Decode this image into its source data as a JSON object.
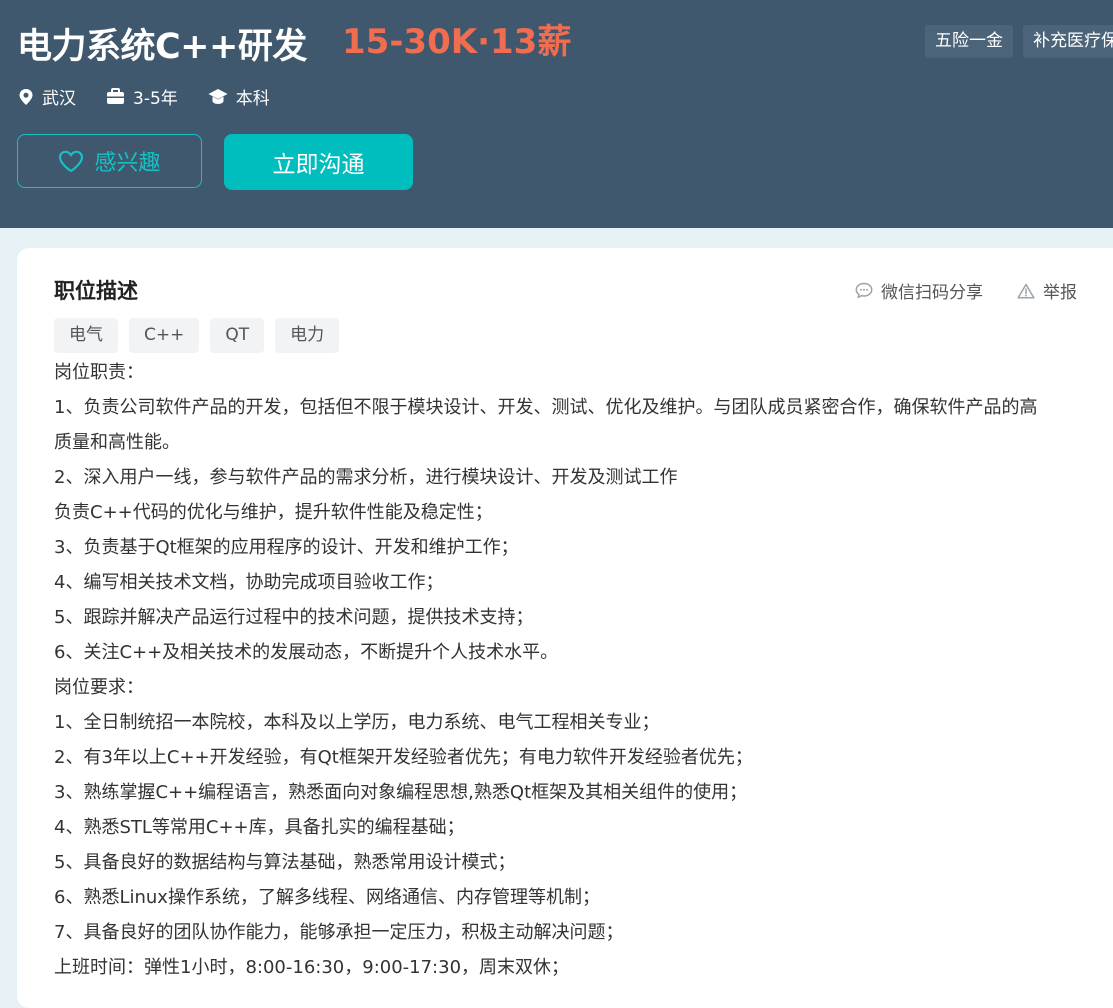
{
  "header": {
    "title": "电力系统C++研发",
    "salary": "15-30K·13薪",
    "benefits": [
      "五险一金",
      "补充医疗保"
    ],
    "meta": {
      "location": "武汉",
      "experience": "3-5年",
      "education": "本科"
    },
    "interest_label": "感兴趣",
    "chat_label": "立即沟通"
  },
  "colors": {
    "header_bg": "#3f586e",
    "accent": "#00bebd",
    "salary": "#f26d4f"
  },
  "description": {
    "title": "职位描述",
    "share_label": "微信扫码分享",
    "report_label": "举报",
    "tags": [
      "电气",
      "C++",
      "QT",
      "电力"
    ],
    "lines": [
      "岗位职责：",
      "1、负责公司软件产品的开发，包括但不限于模块设计、开发、测试、优化及维护。与团队成员紧密合作，确保软件产品的高",
      "质量和高性能。",
      "2、深入用户一线，参与软件产品的需求分析，进行模块设计、开发及测试工作",
      "负责C++代码的优化与维护，提升软件性能及稳定性；",
      "3、负责基于Qt框架的应用程序的设计、开发和维护工作；",
      "4、编写相关技术文档，协助完成项目验收工作；",
      "5、跟踪并解决产品运行过程中的技术问题，提供技术支持；",
      "6、关注C++及相关技术的发展动态，不断提升个人技术水平。",
      "岗位要求：",
      "1、全日制统招一本院校，本科及以上学历，电力系统、电气工程相关专业；",
      "2、有3年以上C++开发经验，有Qt框架开发经验者优先；有电力软件开发经验者优先；",
      "3、熟练掌握C++编程语言，熟悉面向对象编程思想,熟悉Qt框架及其相关组件的使用；",
      "4、熟悉STL等常用C++库，具备扎实的编程基础；",
      "5、具备良好的数据结构与算法基础，熟悉常用设计模式；",
      "6、熟悉Linux操作系统，了解多线程、网络通信、内存管理等机制；",
      "7、具备良好的团队协作能力，能够承担一定压力，积极主动解决问题；",
      "上班时间：弹性1小时，8:00-16:30，9:00-17:30，周末双休；"
    ]
  },
  "icons": {
    "location": "location-pin-icon",
    "experience": "briefcase-icon",
    "education": "graduation-cap-icon",
    "interest": "heart-icon",
    "share": "chat-bubble-icon",
    "report": "warning-icon"
  }
}
